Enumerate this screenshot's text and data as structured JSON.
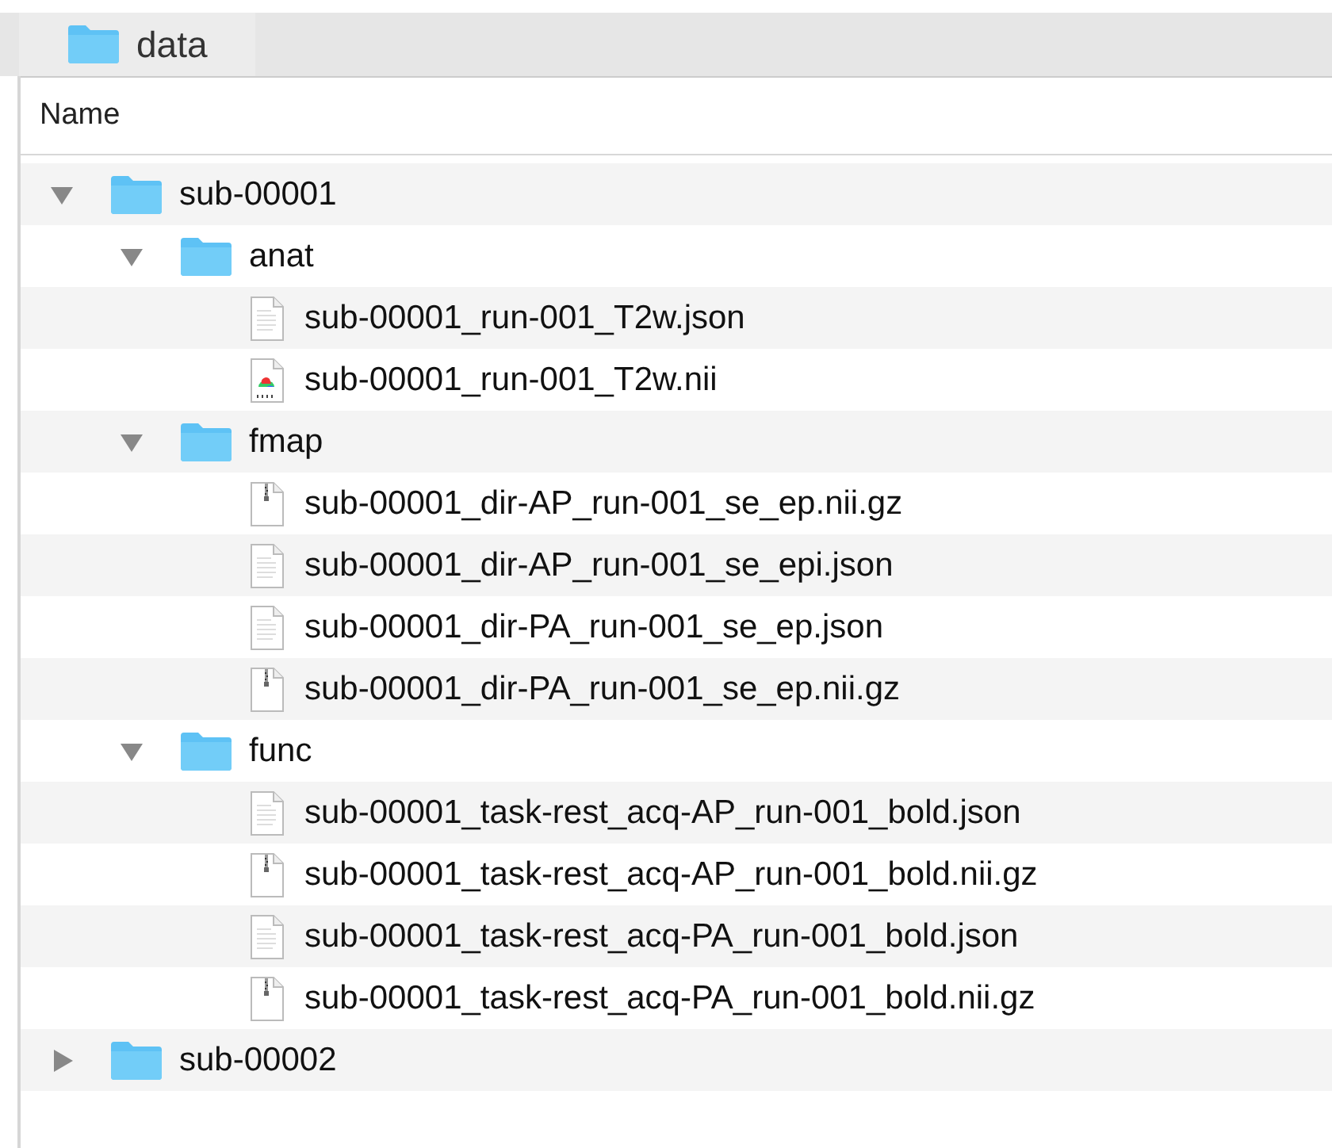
{
  "window": {
    "tab": "data"
  },
  "table": {
    "columns": [
      "Name"
    ],
    "tree": [
      {
        "name": "sub-00001",
        "kind": "folder",
        "expanded": true,
        "children": [
          {
            "name": "anat",
            "kind": "folder",
            "expanded": true,
            "children": [
              {
                "name": "sub-00001_run-001_T2w.json",
                "kind": "text"
              },
              {
                "name": "sub-00001_run-001_T2w.nii",
                "kind": "nifti"
              }
            ]
          },
          {
            "name": "fmap",
            "kind": "folder",
            "expanded": true,
            "children": [
              {
                "name": "sub-00001_dir-AP_run-001_se_ep.nii.gz",
                "kind": "archive"
              },
              {
                "name": "sub-00001_dir-AP_run-001_se_epi.json",
                "kind": "text"
              },
              {
                "name": "sub-00001_dir-PA_run-001_se_ep.json",
                "kind": "text"
              },
              {
                "name": "sub-00001_dir-PA_run-001_se_ep.nii.gz",
                "kind": "archive"
              }
            ]
          },
          {
            "name": "func",
            "kind": "folder",
            "expanded": true,
            "children": [
              {
                "name": "sub-00001_task-rest_acq-AP_run-001_bold.json",
                "kind": "text"
              },
              {
                "name": "sub-00001_task-rest_acq-AP_run-001_bold.nii.gz",
                "kind": "archive"
              },
              {
                "name": "sub-00001_task-rest_acq-PA_run-001_bold.json",
                "kind": "text"
              },
              {
                "name": "sub-00001_task-rest_acq-PA_run-001_bold.nii.gz",
                "kind": "archive"
              }
            ]
          }
        ]
      },
      {
        "name": "sub-00002",
        "kind": "folder",
        "expanded": false
      }
    ]
  }
}
